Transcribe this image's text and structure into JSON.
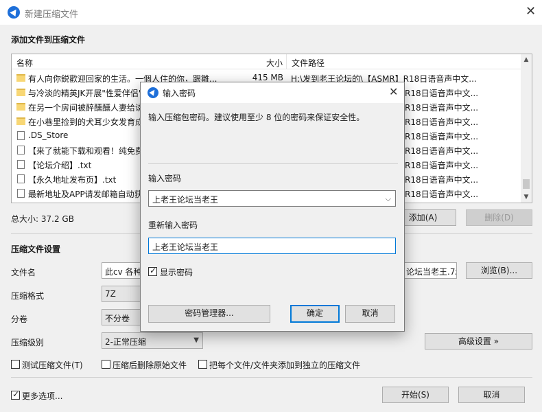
{
  "window": {
    "title": "新建压缩文件",
    "close_icon": "close-icon",
    "app_icon": "bandizip-icon"
  },
  "add_section": {
    "heading": "添加文件到压缩文件"
  },
  "file_list": {
    "columns": {
      "name": "名称",
      "size": "大小",
      "path": "文件路径"
    },
    "rows": [
      {
        "name": "有人向你鋭歡迎回家的生活。一個人住的你，跟雛...",
        "size": "415 MB",
        "path": "H:\\发到老王论坛的\\【ASMR】R18日语音声中文...",
        "icon": "folder-icon"
      },
      {
        "name": "与冷淡的精英JK开展\"性爱伴侣\"",
        "size": "",
        "path": "R18日语音声中文...",
        "icon": "folder-icon"
      },
      {
        "name": "在另一个房间被醉醺醺人妻给诱",
        "size": "",
        "path": "R18日语音声中文...",
        "icon": "folder-icon"
      },
      {
        "name": "在小巷里捡到的犬耳少女发育成",
        "size": "",
        "path": "R18日语音声中文...",
        "icon": "folder-icon"
      },
      {
        "name": ".DS_Store",
        "size": "",
        "path": "R18日语音声中文...",
        "icon": "file-icon"
      },
      {
        "name": "【来了就能下载和观看！纯免费",
        "size": "",
        "path": "R18日语音声中文...",
        "icon": "file-icon"
      },
      {
        "name": "【论坛介绍】.txt",
        "size": "",
        "path": "R18日语音声中文...",
        "icon": "file-icon"
      },
      {
        "name": "【永久地址发布页】.txt",
        "size": "",
        "path": "R18日语音声中文...",
        "icon": "file-icon"
      },
      {
        "name": "最新地址及APP请发邮箱自动获",
        "size": "",
        "path": "R18日语音声中文...",
        "icon": "file-icon"
      }
    ]
  },
  "total_size": "总大小: 37.2 GB",
  "buttons": {
    "add": "添加(A)",
    "delete": "删除(D)",
    "browse": "浏览(B)...",
    "advanced": "高级设置 »",
    "start": "开始(S)",
    "cancel": "取消"
  },
  "settings": {
    "heading": "压缩文件设置",
    "filename_label": "文件名",
    "filename_value_left": "此cv 各种声",
    "filename_value_right": "论坛当老王.7z",
    "format_label": "压缩格式",
    "format_value": "7Z",
    "split_label": "分卷",
    "split_value": "不分卷",
    "level_label": "压缩级别",
    "level_value": "2-正常压缩",
    "test_archive": "测试压缩文件(T)",
    "delete_after": "压缩后删除原始文件",
    "each_separate": "把每个文件/文件夹添加到独立的压缩文件",
    "more_options": "更多选项..."
  },
  "dialog": {
    "title": "输入密码",
    "description": "输入压缩包密码。建议使用至少 8 位的密码来保证安全性。",
    "password_label": "输入密码",
    "password_value": "上老王论坛当老王",
    "confirm_label": "重新输入密码",
    "confirm_value": "上老王论坛当老王",
    "show_password": "显示密码",
    "manager_button": "密码管理器...",
    "ok_button": "确定",
    "cancel_button": "取消"
  }
}
